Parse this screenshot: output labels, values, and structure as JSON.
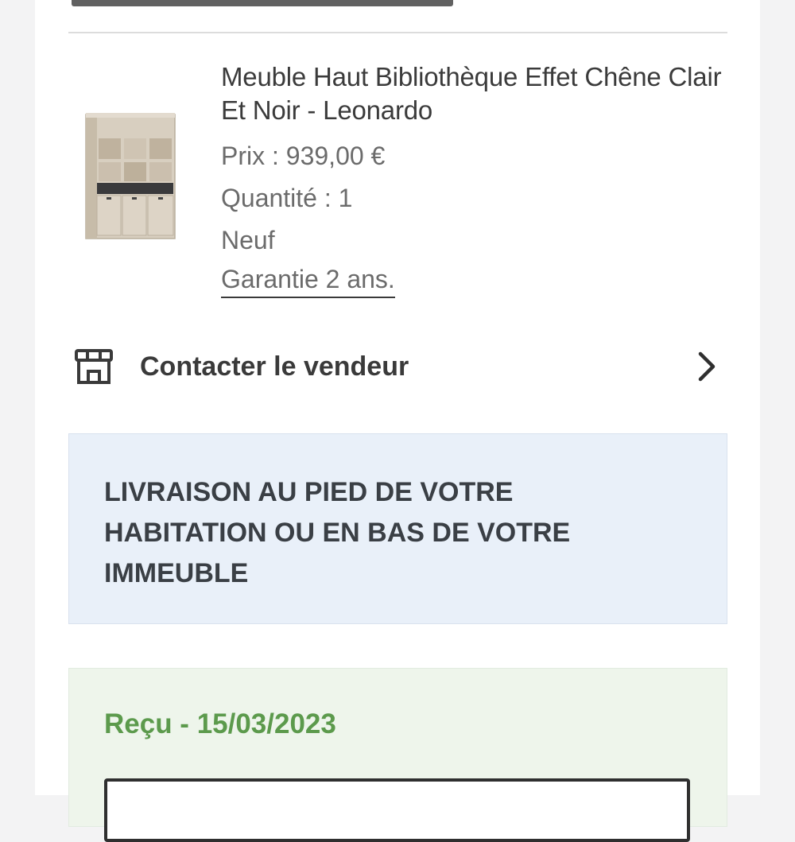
{
  "product": {
    "title": "Meuble Haut Bibliothèque Effet Chêne Clair Et Noir - Leonardo",
    "price": "Prix : 939,00 €",
    "quantity": "Quantité : 1",
    "condition": "Neuf",
    "warranty": "Garantie 2 ans.",
    "image_icon": "bookcase-image"
  },
  "contact": {
    "label": "Contacter le vendeur",
    "icon": "store-icon",
    "chevron": "chevron-right-icon"
  },
  "delivery": {
    "text": "LIVRAISON AU PIED DE VOTRE HABITATION OU EN BAS DE VOTRE IMMEUBLE",
    "background": "#e9f0f9"
  },
  "status": {
    "text": "Reçu - 15/03/2023",
    "color": "#5c9a4c",
    "background": "#eef5eb"
  }
}
